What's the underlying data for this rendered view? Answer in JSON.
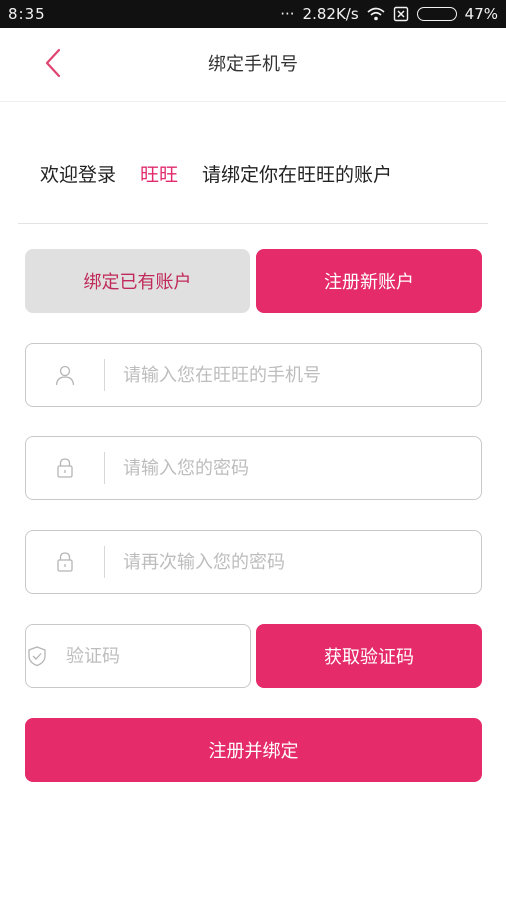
{
  "status_bar": {
    "time": "8:35",
    "dots": "···",
    "network_speed": "2.82K/s",
    "battery_percent": "47%",
    "battery_level": 0.47
  },
  "header": {
    "title": "绑定手机号"
  },
  "welcome": {
    "prefix": "欢迎登录",
    "app_name": "旺旺",
    "suffix": "请绑定你在旺旺的账户"
  },
  "tabs": {
    "bind_existing": "绑定已有账户",
    "register_new": "注册新账户"
  },
  "form": {
    "phone_placeholder": "请输入您在旺旺的手机号",
    "phone_value": "",
    "password_placeholder": "请输入您的密码",
    "password_value": "",
    "confirm_password_placeholder": "请再次输入您的密码",
    "confirm_password_value": "",
    "code_placeholder": "验证码",
    "code_value": "",
    "get_code_label": "获取验证码",
    "submit_label": "注册并绑定"
  },
  "colors": {
    "accent": "#e52b6a",
    "tab_inactive_bg": "#e0e0e0",
    "status_bar_bg": "#111111"
  },
  "icons": {
    "back": "chevron-left-icon",
    "phone_field": "user-icon",
    "password_field": "lock-icon",
    "confirm_password_field": "lock-icon",
    "code_field": "shield-check-icon"
  }
}
